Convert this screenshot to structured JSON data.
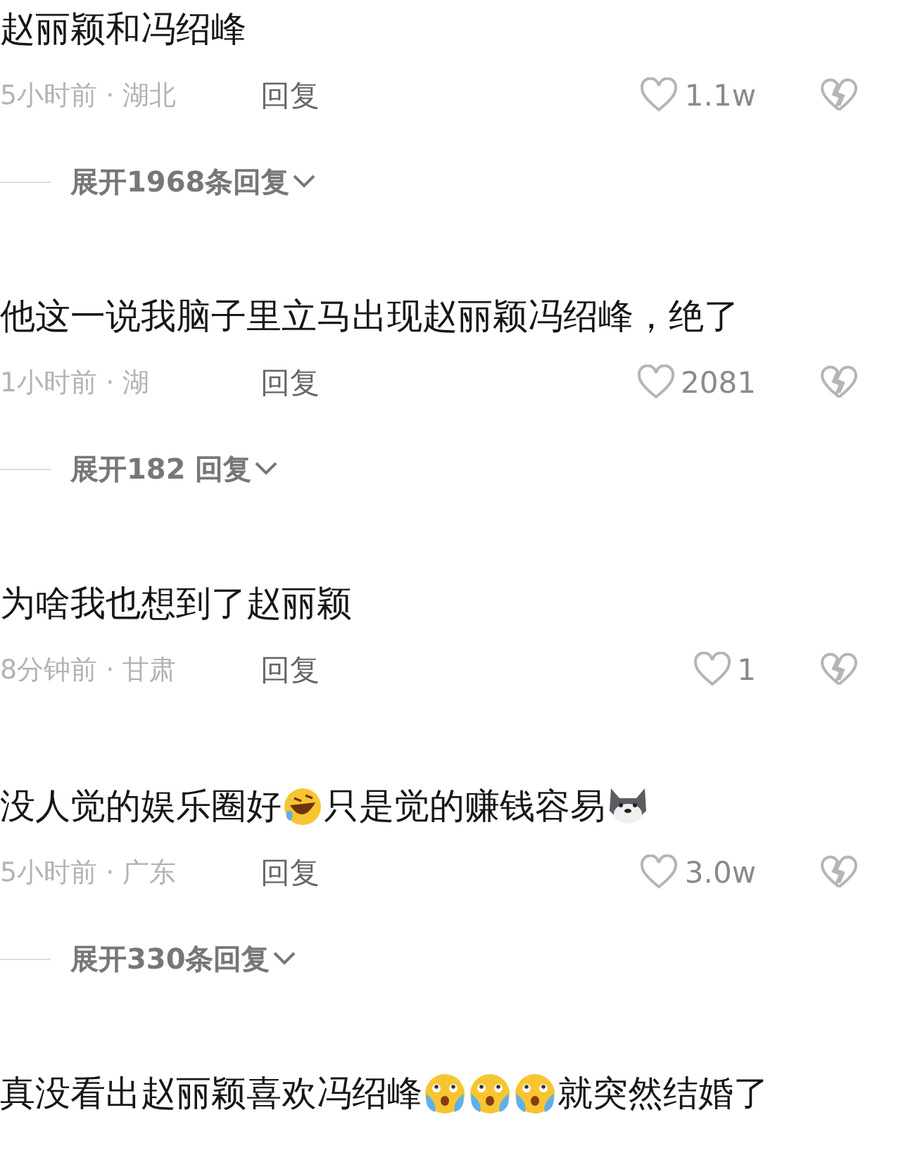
{
  "comments": [
    {
      "content": [
        {
          "kind": "text",
          "text": "赵丽颖和冯绍峰"
        }
      ],
      "time": "5小时前 · 湖北",
      "reply": "回复",
      "likes": "1.1w",
      "expand": "展开1968条回复"
    },
    {
      "content": [
        {
          "kind": "text",
          "text": "他这一说我脑子里立马出现赵丽颖冯绍峰，绝了"
        }
      ],
      "time": "1小时前 · 湖",
      "reply": "回复",
      "likes": "2081",
      "expand": "展开182 回复"
    },
    {
      "content": [
        {
          "kind": "text",
          "text": "为啥我也想到了赵丽颖"
        }
      ],
      "time": "8分钟前 · 甘肃",
      "reply": "回复",
      "likes": "1"
    },
    {
      "content": [
        {
          "kind": "text",
          "text": "没人觉的娱乐圈好"
        },
        {
          "kind": "laugh"
        },
        {
          "kind": "text",
          "text": "只是觉的赚钱容易"
        },
        {
          "kind": "dog"
        }
      ],
      "time": "5小时前 · 广东",
      "reply": "回复",
      "likes": "3.0w",
      "expand": "展开330条回复"
    },
    {
      "content": [
        {
          "kind": "text",
          "text": "真没看出赵丽颖喜欢冯绍峰"
        },
        {
          "kind": "cry"
        },
        {
          "kind": "cry"
        },
        {
          "kind": "cry"
        },
        {
          "kind": "text",
          "text": "就突然结婚了"
        }
      ]
    }
  ]
}
